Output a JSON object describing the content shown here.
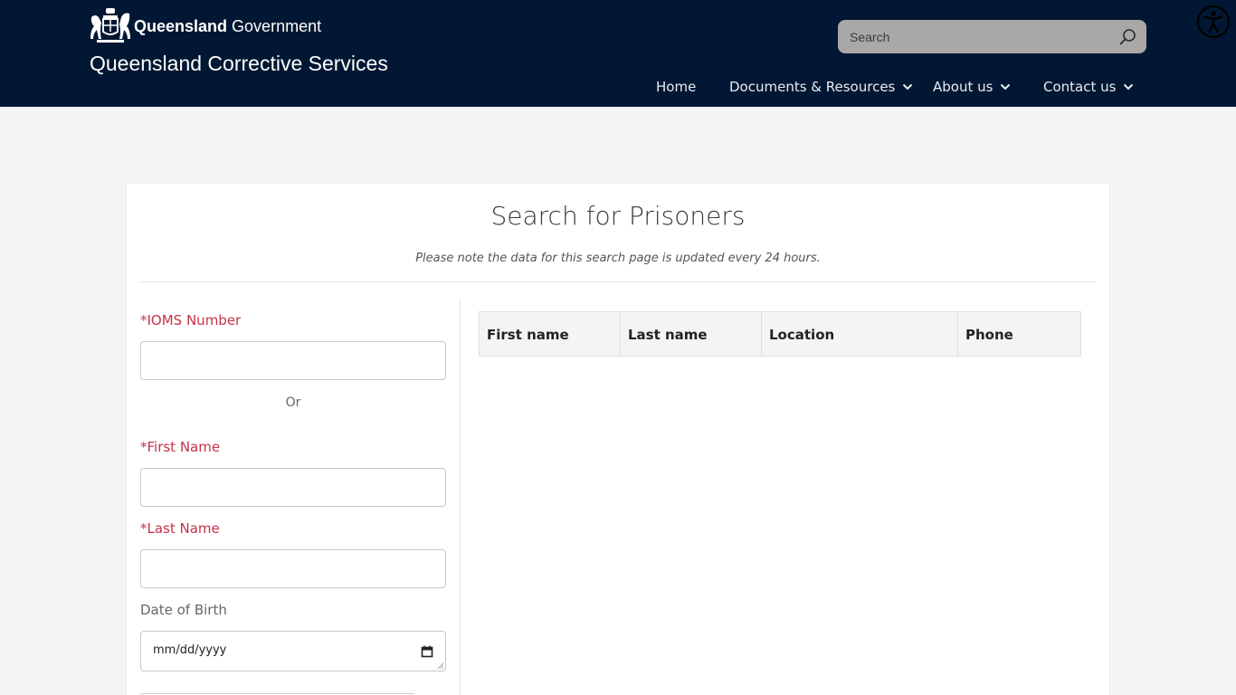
{
  "header": {
    "gov_name_bold": "Queensland",
    "gov_name_regular": "Government",
    "site_title": "Queensland Corrective Services",
    "search": {
      "placeholder": "Search",
      "value": ""
    },
    "nav": [
      {
        "label": "Home",
        "has_dropdown": false
      },
      {
        "label": "Documents & Resources",
        "has_dropdown": true
      },
      {
        "label": "About us",
        "has_dropdown": true
      },
      {
        "label": "Contact us",
        "has_dropdown": true
      }
    ],
    "colors": {
      "background": "#011733",
      "search_bg": "#a9a7a7"
    }
  },
  "page": {
    "title": "Search for Prisoners",
    "note": "Please note the data for this search page is updated every 24 hours."
  },
  "form": {
    "iomS_label": "*IOMS Number",
    "iomS_value": "",
    "or_text": "Or",
    "first_name_label": "*First Name",
    "first_name_value": "",
    "last_name_label": "*Last Name",
    "last_name_value": "",
    "dob_label": "Date of Birth",
    "dob_placeholder": "mm/dd/yyyy",
    "required_color": "#c4324a"
  },
  "results": {
    "columns": [
      "First name",
      "Last name",
      "Location",
      "Phone"
    ],
    "rows": []
  }
}
